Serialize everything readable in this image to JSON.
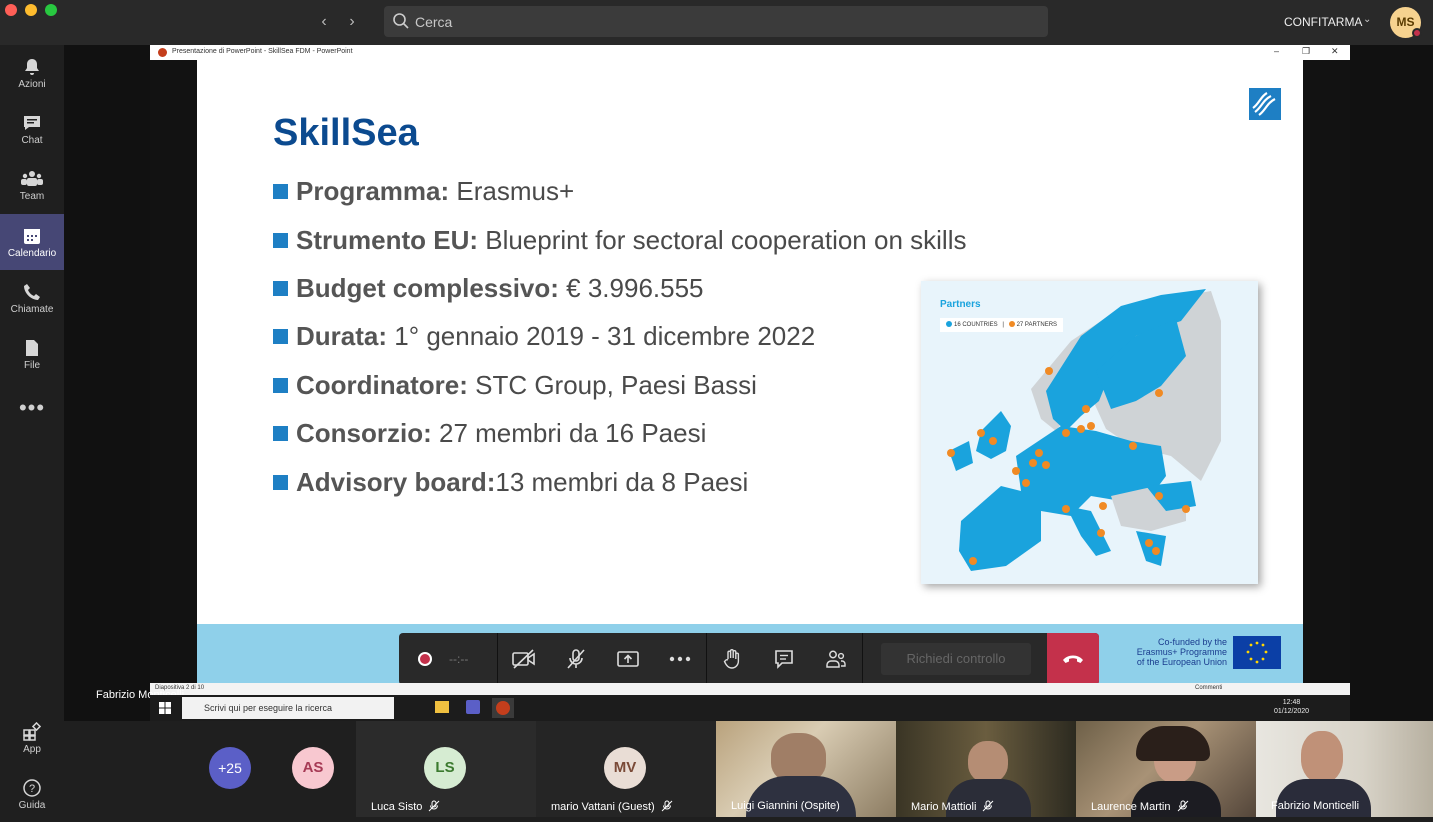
{
  "window": {
    "search_placeholder": "Cerca",
    "org_name": "CONFITARMA",
    "user_initials": "MS"
  },
  "rail": {
    "items": [
      {
        "label": "Azioni",
        "icon": "bell-icon"
      },
      {
        "label": "Chat",
        "icon": "chat-icon"
      },
      {
        "label": "Team",
        "icon": "teams-icon"
      },
      {
        "label": "Calendario",
        "icon": "calendar-icon",
        "active": true
      },
      {
        "label": "Chiamate",
        "icon": "phone-icon"
      },
      {
        "label": "File",
        "icon": "file-icon"
      }
    ],
    "more": "•••",
    "bottom": [
      {
        "label": "App",
        "icon": "apps-icon"
      },
      {
        "label": "Guida",
        "icon": "help-icon"
      }
    ]
  },
  "powerpoint": {
    "window_title": "Presentazione di PowerPoint - SkillSea FDM - PowerPoint",
    "status_left": "Diapositiva 2 di 10",
    "status_comments": "Commenti"
  },
  "slide": {
    "title": "SkillSea",
    "bullets": [
      {
        "key": "Programma:",
        "value": " Erasmus+"
      },
      {
        "key": "Strumento EU:",
        "value": " Blueprint for sectoral cooperation on skills"
      },
      {
        "key": "Budget complessivo:",
        "value": " € 3.996.555"
      },
      {
        "key": "Durata:",
        "value": " 1° gennaio 2019 - 31 dicembre 2022"
      },
      {
        "key": "Coordinatore:",
        "value": " STC Group, Paesi Bassi"
      },
      {
        "key": "Consorzio:",
        "value": " 27 membri da 16 Paesi"
      },
      {
        "key": "Advisory board:",
        "value": "13 membri da 8 Paesi"
      }
    ],
    "map": {
      "title": "Partners",
      "legend_countries": "16 COUNTRIES",
      "legend_partners": "27 PARTNERS",
      "countries_color": "#1aa3dd",
      "partners_color": "#f08a24"
    },
    "footer": {
      "eu_text_1": "Co-funded by the",
      "eu_text_2": "Erasmus+ Programme",
      "eu_text_3": "of the European Union"
    }
  },
  "controls": {
    "rec_time": "--:--",
    "request_control": "Richiedi controllo"
  },
  "presenter_caption": "Fabrizio Monticelli",
  "taskbar": {
    "search_placeholder": "Scrivi qui per eseguire la ricerca",
    "time": "12:48",
    "date": "01/12/2020"
  },
  "participants": {
    "overflow": "+25",
    "tiles": [
      {
        "initials": "AS",
        "name": ""
      },
      {
        "initials": "LS",
        "name": "Luca Sisto"
      },
      {
        "initials": "MV",
        "name": "mario Vattani (Guest)"
      },
      {
        "initials": "",
        "name": "Luigi Giannini (Ospite)"
      },
      {
        "initials": "",
        "name": "Mario Mattioli"
      },
      {
        "initials": "",
        "name": "Laurence Martin"
      },
      {
        "initials": "",
        "name": "Fabrizio Monticelli"
      }
    ]
  }
}
